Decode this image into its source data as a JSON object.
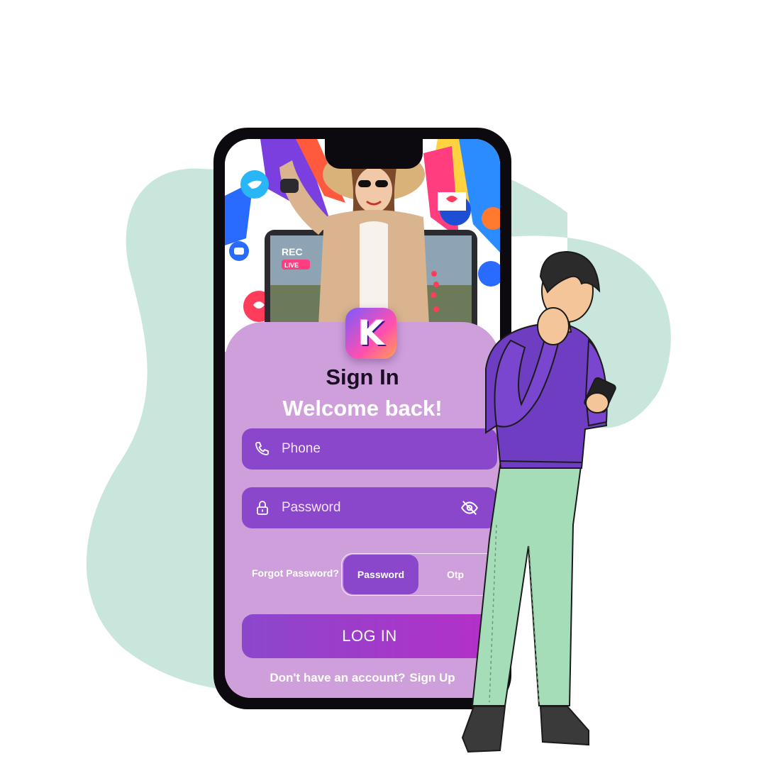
{
  "app": {
    "logo_letter": "K"
  },
  "signin": {
    "title": "Sign In",
    "subtitle": "Welcome back!",
    "phone_placeholder": "Phone",
    "password_placeholder": "Password",
    "forgot_label": "Forgot Password?",
    "mode_toggle": {
      "options": [
        "Password",
        "Otp"
      ],
      "selected": "Password"
    },
    "login_label": "LOG IN",
    "no_account_text": "Don't have an account?",
    "signup_label": "Sign Up"
  },
  "hero": {
    "rec_label": "REC",
    "live_label": "LIVE"
  },
  "icons": {
    "phone": "phone-icon",
    "password": "lock-icon",
    "visibility": "eye-off-icon"
  },
  "colors": {
    "card": "#cf9fdc",
    "field": "#8b47cc",
    "login_gradient_end": "#b52fc8",
    "blob": "#c9e6dc"
  }
}
